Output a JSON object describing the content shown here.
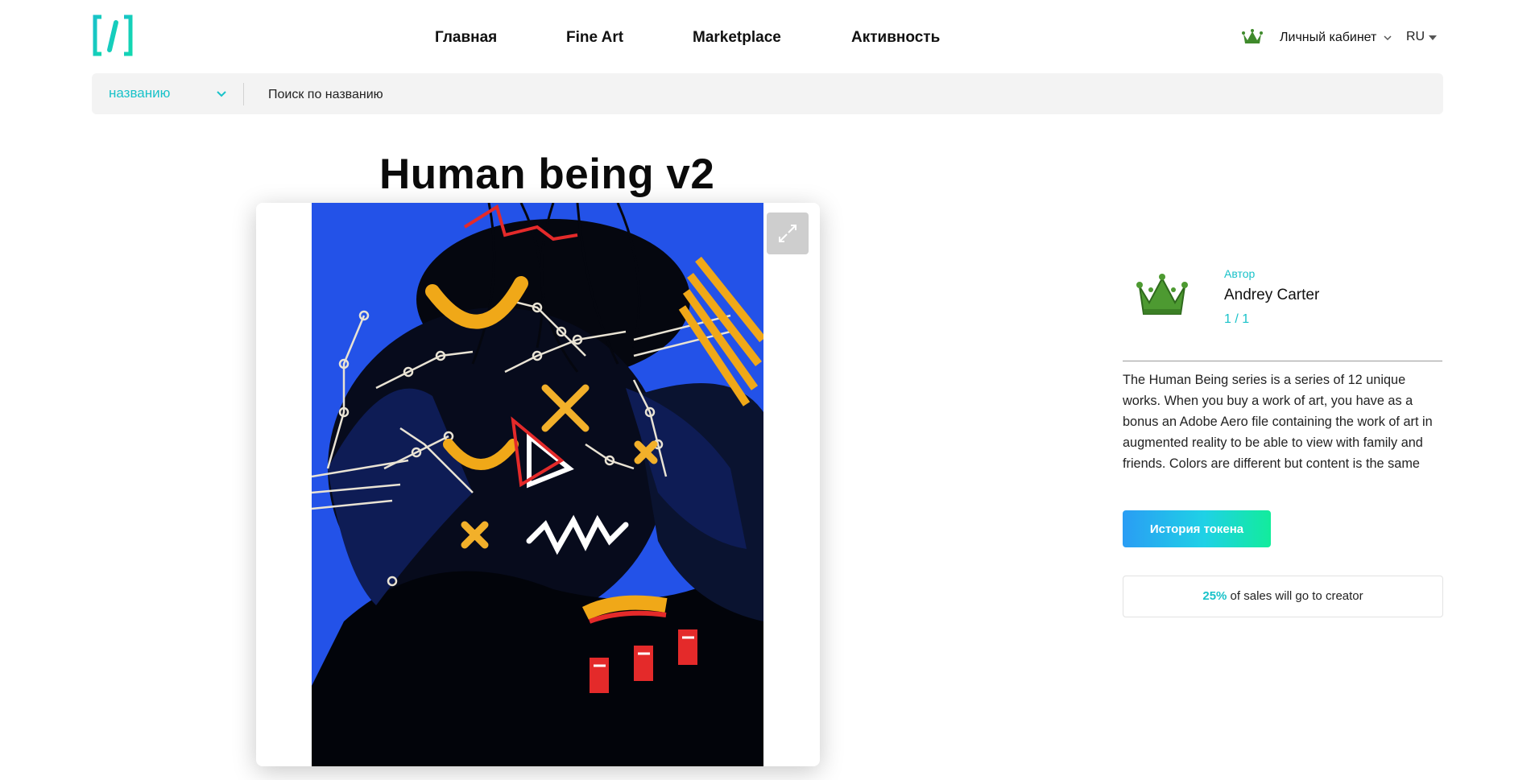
{
  "header": {
    "logo_icon": "bracket-i-logo",
    "nav": [
      "Главная",
      "Fine Art",
      "Marketplace",
      "Активность"
    ],
    "cabinet_label": "Личный кабинет",
    "language": "RU"
  },
  "search": {
    "filter_value": "названию",
    "placeholder": "Поиск по названию"
  },
  "artwork": {
    "title": "Human being v2"
  },
  "author": {
    "label": "Автор",
    "name": "Andrey Carter",
    "edition": "1 / 1",
    "description": "The Human Being series is a series of 12 unique works. When you buy a work of art, you have as a bonus an Adobe Aero file containing the work of art in augmented reality to be able to view with family and friends. Colors are different but content is the same",
    "token_history_button": "История токена",
    "royalty_percent": "25%",
    "royalty_text": " of sales will go to creator"
  },
  "colors": {
    "accent": "#19c2c9",
    "button_gradient_start": "#2a9df4",
    "button_gradient_end": "#12ec9c",
    "art_background": "#2352e8"
  }
}
